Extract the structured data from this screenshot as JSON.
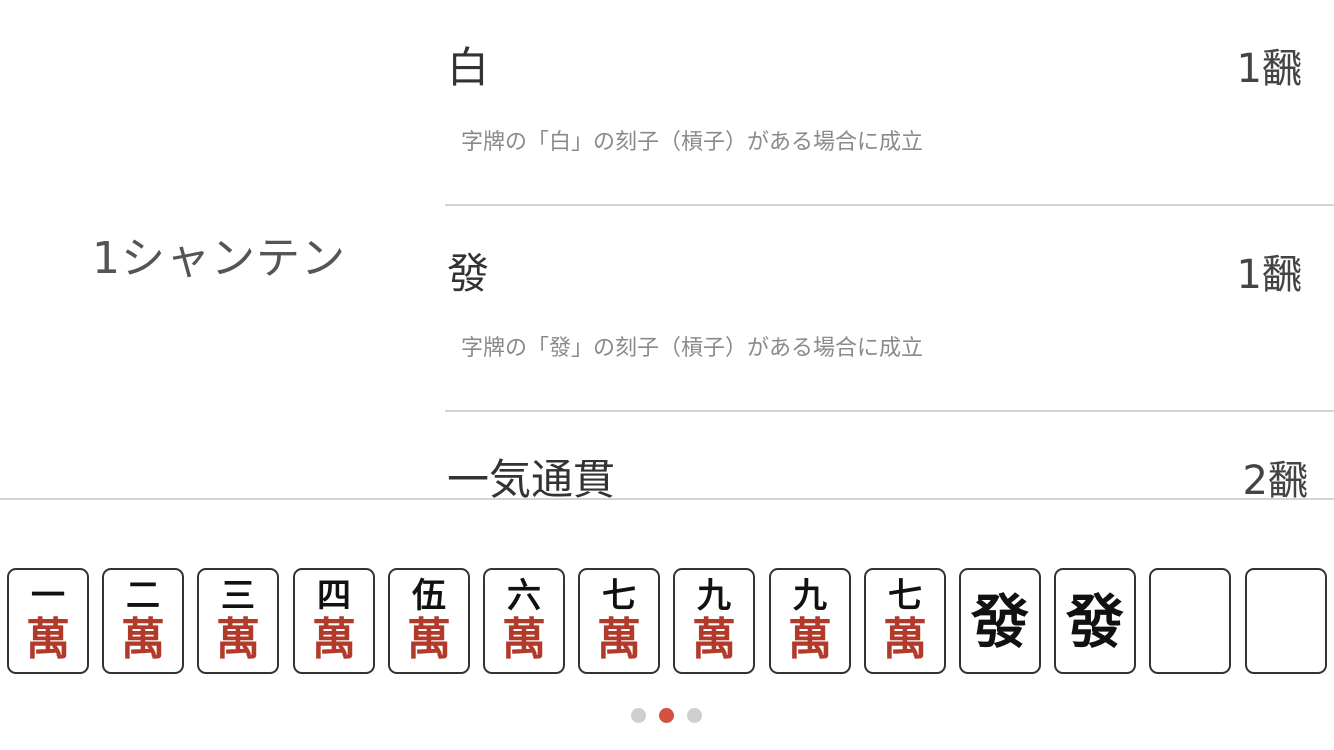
{
  "shanten_label": "1シャンテン",
  "yaku": [
    {
      "name": "白",
      "han": "1飜",
      "description": "字牌の「白」の刻子（槓子）がある場合に成立"
    },
    {
      "name": "發",
      "han": "1飜",
      "description": "字牌の「發」の刻子（槓子）がある場合に成立"
    },
    {
      "name": "一気通貫",
      "han": "2飜",
      "description": ""
    }
  ],
  "hand": {
    "tiles": [
      {
        "rank": "一",
        "suit": "萬",
        "kind": "man"
      },
      {
        "rank": "二",
        "suit": "萬",
        "kind": "man"
      },
      {
        "rank": "三",
        "suit": "萬",
        "kind": "man"
      },
      {
        "rank": "四",
        "suit": "萬",
        "kind": "man"
      },
      {
        "rank": "伍",
        "suit": "萬",
        "kind": "man"
      },
      {
        "rank": "六",
        "suit": "萬",
        "kind": "man"
      },
      {
        "rank": "七",
        "suit": "萬",
        "kind": "man"
      },
      {
        "rank": "九",
        "suit": "萬",
        "kind": "man"
      },
      {
        "rank": "九",
        "suit": "萬",
        "kind": "man"
      },
      {
        "rank": "七",
        "suit": "萬",
        "kind": "man"
      },
      {
        "rank": "發",
        "suit": "",
        "kind": "honor"
      },
      {
        "rank": "發",
        "suit": "",
        "kind": "honor"
      },
      {
        "rank": "",
        "suit": "",
        "kind": "blank"
      },
      {
        "rank": "",
        "suit": "",
        "kind": "blank"
      }
    ]
  },
  "pager": {
    "count": 3,
    "active_index": 1
  },
  "colors": {
    "text_primary": "#333333",
    "text_secondary": "#8a8a8a",
    "divider": "#d4d4d4",
    "manzu_red": "#b23a2a",
    "pager_active": "#d5503f",
    "pager_inactive": "#cfcfcf"
  }
}
